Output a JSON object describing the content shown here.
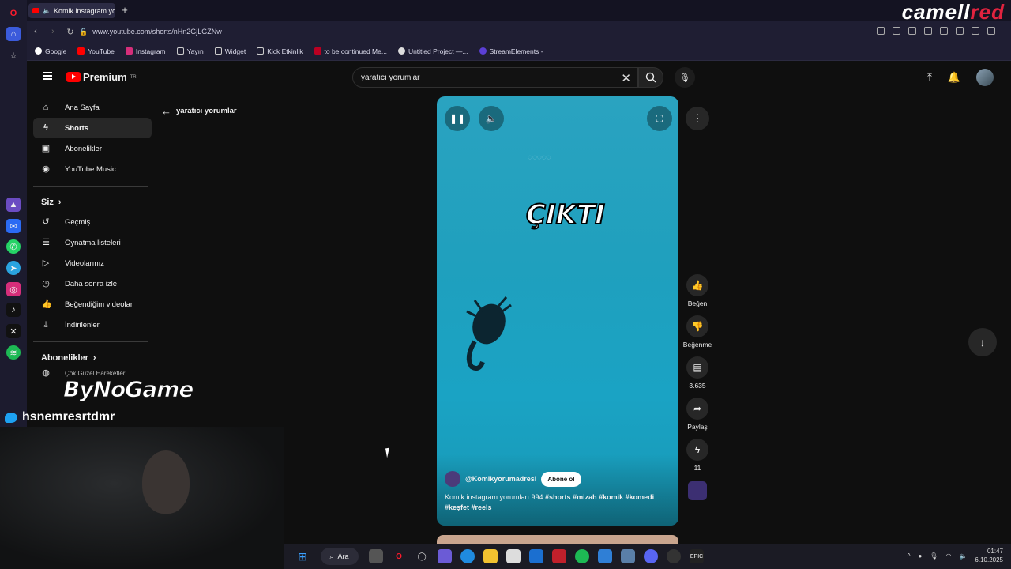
{
  "browser": {
    "tab_title": "Komik instagram yoru",
    "url": "www.youtube.com/shorts/nHn2GjLGZNw",
    "bookmarks": [
      "Google",
      "YouTube",
      "Instagram",
      "Yayın",
      "Widget",
      "Kick Etkinlik",
      "to be continued Me...",
      "Untitled Project —...",
      "StreamElements -"
    ]
  },
  "stream_brand": {
    "text_main": "camell",
    "text_accent": "red"
  },
  "youtube": {
    "logo": "Premium",
    "logo_region": "TR",
    "search_value": "yaratıcı yorumlar",
    "back_label": "yaratıcı yorumlar",
    "sidebar_main": [
      "Ana Sayfa",
      "Shorts",
      "Abonelikler",
      "YouTube Music"
    ],
    "you_header": "Siz",
    "sidebar_you": [
      "Geçmiş",
      "Oynatma listeleri",
      "Videolarınız",
      "Daha sonra izle",
      "Beğendiğim videolar",
      "İndirilenler"
    ],
    "subs_header": "Abonelikler",
    "subs_items": [
      "Çok Güzel Hareketler"
    ]
  },
  "short": {
    "overlay_text": "ÇIKTI",
    "channel": "@Komikyorumadresi",
    "subscribe_label": "Abone ol",
    "description_plain": "Komik instagram yorumları 994 ",
    "hashtags": "#shorts #mizah #komik #komedi #keşfet #reels"
  },
  "actions": {
    "like": "Beğen",
    "dislike": "Beğenme",
    "comments": "3.635",
    "share": "Paylaş",
    "remix": "11"
  },
  "stream_overlay": {
    "sponsor_main": "ByNo",
    "sponsor_accent": "Game",
    "twitter_handle": "hsnemresrtdmr"
  },
  "taskbar": {
    "search_label": "Ara",
    "time": "01:47",
    "date": "6.10.2025"
  }
}
